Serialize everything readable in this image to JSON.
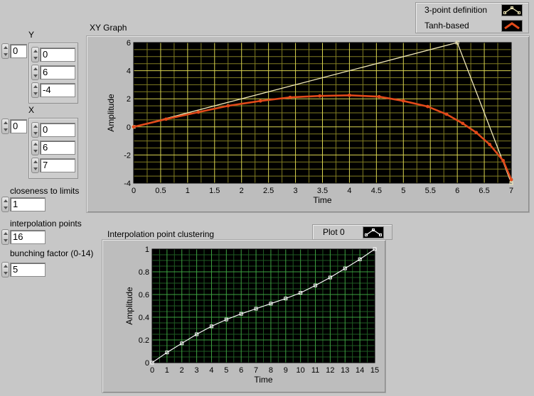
{
  "controls": {
    "y": {
      "label": "Y",
      "index": "0",
      "values": [
        "0",
        "6",
        "-4"
      ]
    },
    "x": {
      "label": "X",
      "index": "0",
      "values": [
        "0",
        "6",
        "7"
      ]
    },
    "closeness": {
      "label": "closeness to limits",
      "value": "1"
    },
    "interp_points": {
      "label": "interpolation points",
      "value": "16"
    },
    "bunching": {
      "label": "bunching factor (0-14)",
      "value": "5"
    }
  },
  "xy_graph": {
    "title": "XY Graph",
    "legend": [
      {
        "name": "3-point definition",
        "color": "#f0e8b8"
      },
      {
        "name": "Tanh-based",
        "color": "#e24a1a"
      }
    ],
    "chart_data": {
      "type": "line",
      "xlabel": "Time",
      "ylabel": "Amplitude",
      "xlim": [
        0,
        7
      ],
      "ylim": [
        -4,
        6
      ],
      "xticks": [
        "0",
        "0.5",
        "1",
        "1.5",
        "2",
        "2.5",
        "3",
        "3.5",
        "4",
        "4.5",
        "5",
        "5.5",
        "6",
        "6.5",
        "7"
      ],
      "yticks": [
        "-4",
        "-2",
        "0",
        "2",
        "4",
        "6"
      ],
      "series": [
        {
          "name": "3-point definition",
          "color": "#f0e8b8",
          "x": [
            0,
            6,
            7
          ],
          "y": [
            0,
            6,
            -4
          ]
        },
        {
          "name": "Tanh-based",
          "color": "#e24a1a",
          "x": [
            0,
            0.6,
            1.2,
            1.75,
            2.35,
            2.9,
            3.45,
            4.0,
            4.55,
            5.0,
            5.45,
            5.8,
            6.1,
            6.35,
            6.6,
            6.85,
            7.0
          ],
          "y": [
            0,
            0.55,
            1.05,
            1.5,
            1.85,
            2.1,
            2.2,
            2.25,
            2.15,
            1.85,
            1.45,
            0.9,
            0.25,
            -0.4,
            -1.25,
            -2.4,
            -3.75
          ]
        }
      ]
    }
  },
  "clustering_graph": {
    "title": "Interpolation point clustering",
    "legend": [
      {
        "name": "Plot 0",
        "color": "#ffffff"
      }
    ],
    "chart_data": {
      "type": "line",
      "xlabel": "Time",
      "ylabel": "Amplitude",
      "xlim": [
        0,
        15
      ],
      "ylim": [
        0,
        1
      ],
      "xticks": [
        "0",
        "1",
        "2",
        "3",
        "4",
        "5",
        "6",
        "7",
        "8",
        "9",
        "10",
        "11",
        "12",
        "13",
        "14",
        "15"
      ],
      "yticks": [
        "0",
        "0.2",
        "0.4",
        "0.6",
        "0.8",
        "1"
      ],
      "series": [
        {
          "name": "Plot 0",
          "color": "#ffffff",
          "x": [
            0,
            1,
            2,
            3,
            4,
            5,
            6,
            7,
            8,
            9,
            10,
            11,
            12,
            13,
            14,
            15
          ],
          "y": [
            0,
            0.09,
            0.17,
            0.25,
            0.32,
            0.38,
            0.43,
            0.475,
            0.52,
            0.565,
            0.615,
            0.68,
            0.75,
            0.83,
            0.91,
            1.0
          ]
        }
      ]
    }
  }
}
